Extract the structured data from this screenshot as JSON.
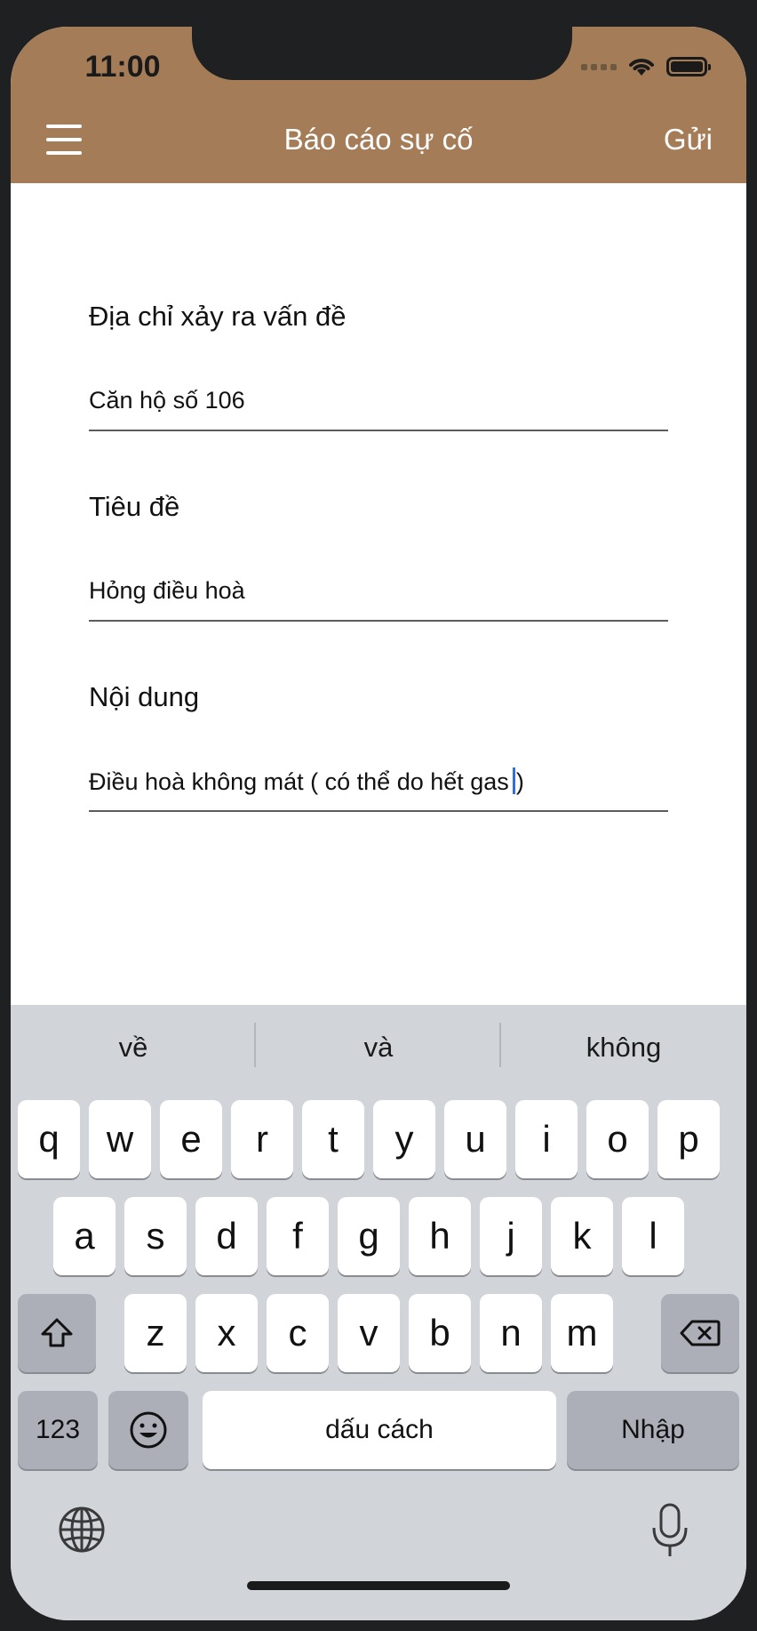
{
  "status_bar": {
    "time": "11:00"
  },
  "nav": {
    "title": "Báo cáo sự cố",
    "send_label": "Gửi"
  },
  "form": {
    "address": {
      "label": "Địa chỉ xảy ra vấn đề",
      "value": "Căn hộ số 106"
    },
    "subject": {
      "label": "Tiêu đề",
      "value": "Hỏng điều hoà"
    },
    "content": {
      "label": "Nội dung",
      "value_before_cursor": "Điều hoà không mát ( có thể do hết gas",
      "value_after_cursor": ")"
    }
  },
  "keyboard": {
    "suggestions": [
      "về",
      "và",
      "không"
    ],
    "row1": [
      "q",
      "w",
      "e",
      "r",
      "t",
      "y",
      "u",
      "i",
      "o",
      "p"
    ],
    "row2": [
      "a",
      "s",
      "d",
      "f",
      "g",
      "h",
      "j",
      "k",
      "l"
    ],
    "row3": [
      "z",
      "x",
      "c",
      "v",
      "b",
      "n",
      "m"
    ],
    "numbers_label": "123",
    "space_label": "dấu cách",
    "return_label": "Nhập"
  },
  "colors": {
    "header": "#a47d58",
    "keyboard_bg": "#d1d4d9",
    "caret": "#2f6fe0"
  }
}
